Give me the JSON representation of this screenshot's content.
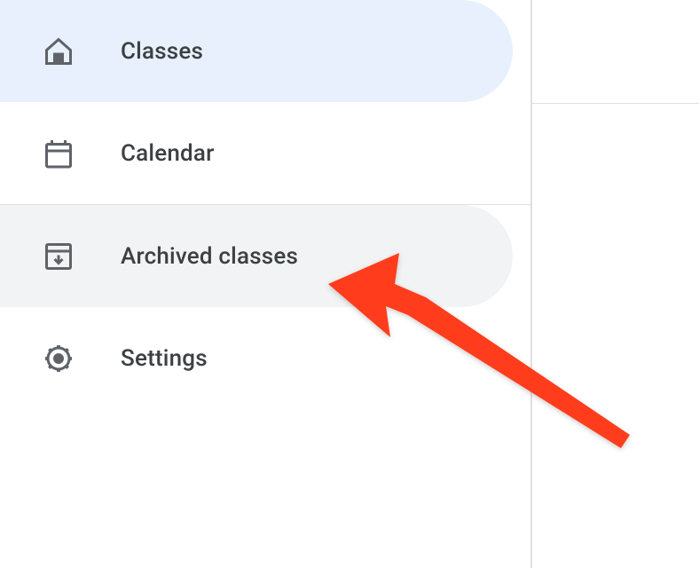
{
  "sidebar": {
    "items": [
      {
        "label": "Classes",
        "icon": "home"
      },
      {
        "label": "Calendar",
        "icon": "calendar"
      },
      {
        "label": "Archived classes",
        "icon": "archive"
      },
      {
        "label": "Settings",
        "icon": "settings"
      }
    ]
  },
  "annotation": {
    "target": "Archived classes",
    "color": "#ff3d1f"
  }
}
